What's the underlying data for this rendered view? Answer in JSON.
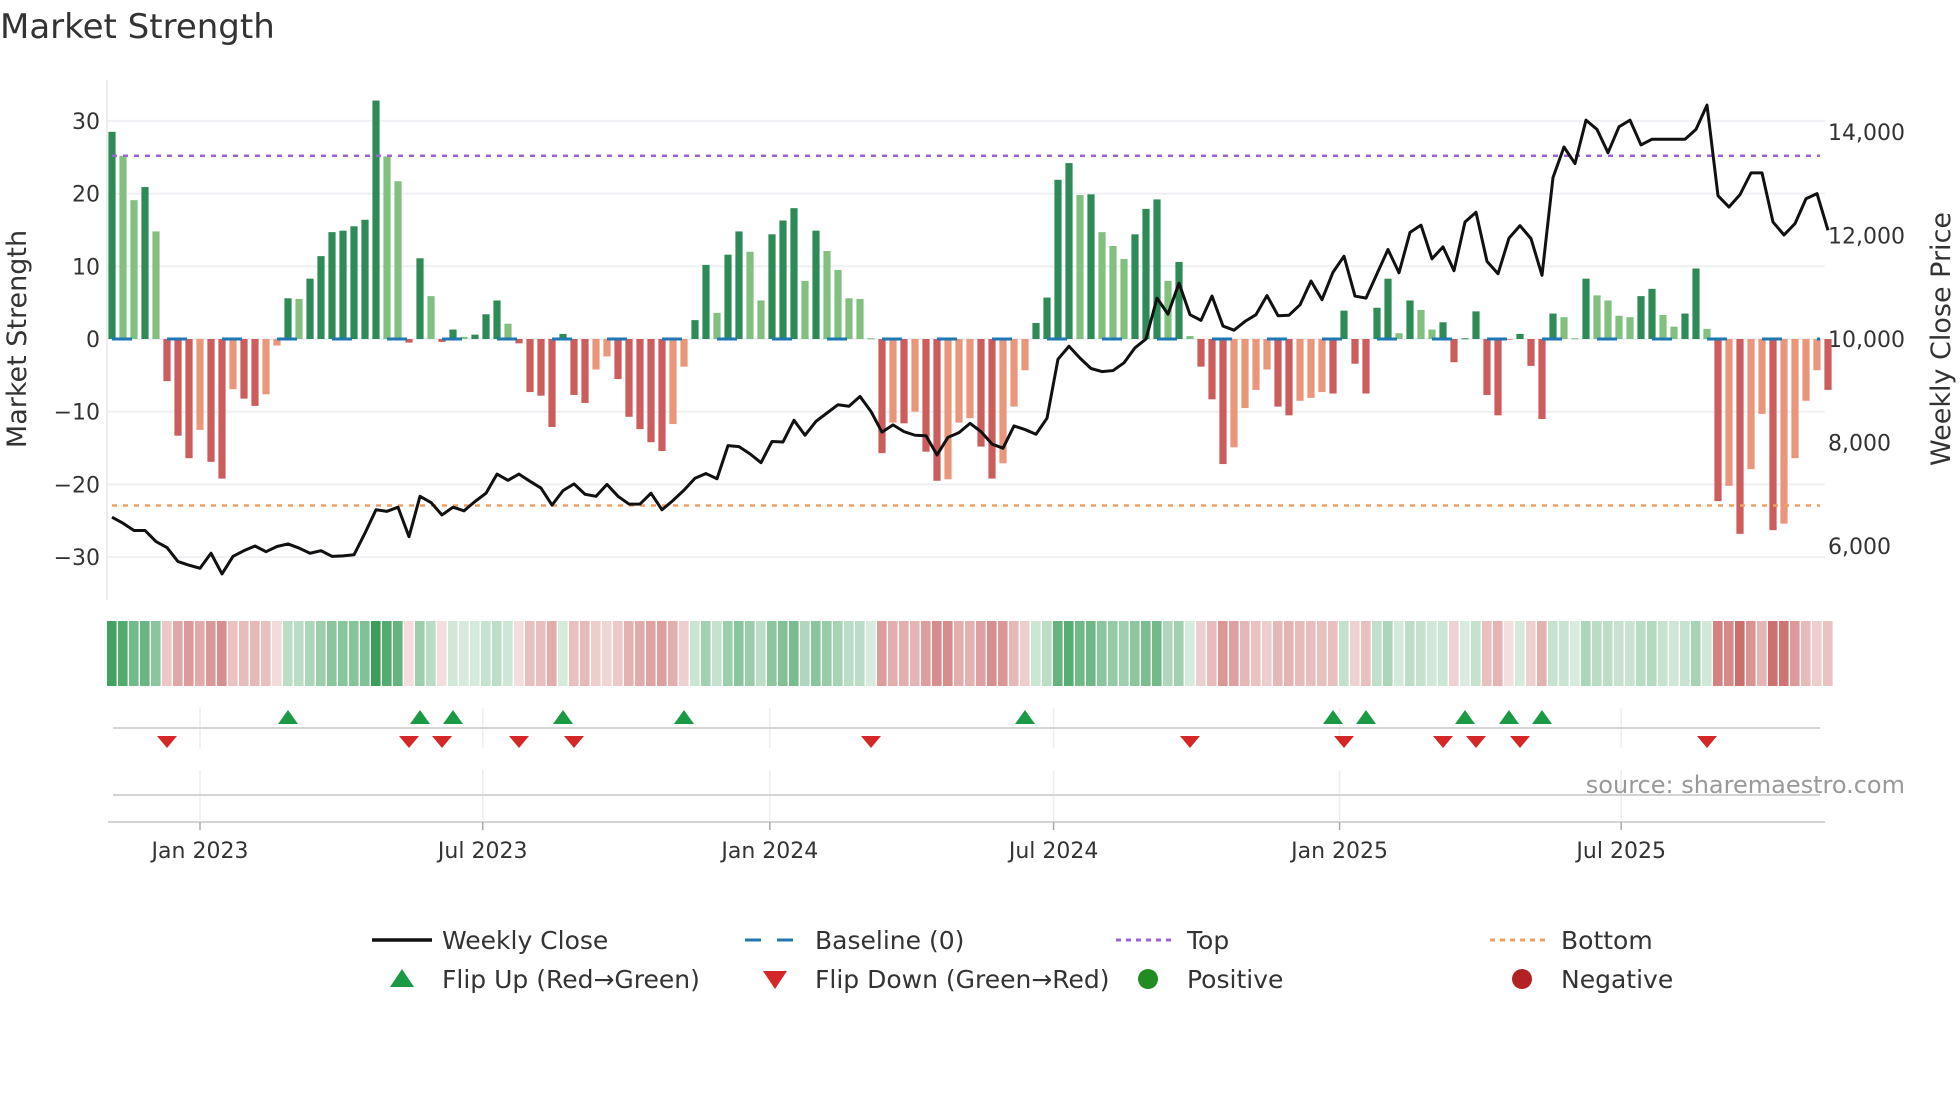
{
  "title": "Market Strength",
  "source": "source: sharemaestro.com",
  "chart_data": {
    "type": "bar",
    "title": "Market Strength",
    "ylabel": "Market Strength",
    "ylabel_right": "Weekly Close Price",
    "ylim": [
      -35.6,
      35.6
    ],
    "ylim_right": [
      4960,
      15000
    ],
    "yticks": [
      30,
      20,
      10,
      0,
      -10,
      -20,
      -30
    ],
    "yticks_right": [
      6000,
      8000,
      10000,
      12000,
      14000
    ],
    "ytick_labels": [
      "30",
      "20",
      "10",
      "0",
      "−10",
      "−20",
      "−30"
    ],
    "ytick_labels_right": [
      "6,000",
      "8,000",
      "10,000",
      "12,000",
      "14,000"
    ],
    "x_unit": "week index (weekly, Nov 2022 – Nov 2025)",
    "xticks": [
      {
        "label": "Jan 2023",
        "week": 8
      },
      {
        "label": "Jul 2023",
        "week": 33.7
      },
      {
        "label": "Jan 2024",
        "week": 59.8
      },
      {
        "label": "Jul 2024",
        "week": 85.6
      },
      {
        "label": "Jan 2025",
        "week": 111.6
      },
      {
        "label": "Jul 2025",
        "week": 137.2
      }
    ],
    "top_threshold": 25.2,
    "bottom_threshold": -22.9,
    "baseline": 0,
    "strength": [
      28.5,
      25.2,
      19.1,
      20.9,
      14.8,
      -5.8,
      -13.3,
      -16.4,
      -12.5,
      -16.9,
      -19.2,
      -6.9,
      -8.2,
      -9.2,
      -7.6,
      -0.9,
      5.6,
      5.5,
      8.3,
      11.4,
      14.7,
      14.9,
      15.5,
      16.4,
      32.8,
      25.1,
      21.7,
      -0.5,
      11.1,
      5.9,
      -0.4,
      1.3,
      0.3,
      0.6,
      3.4,
      5.3,
      2.1,
      -0.6,
      -7.3,
      -7.8,
      -12.1,
      0.7,
      -7.7,
      -8.8,
      -4.2,
      -2.4,
      -5.5,
      -10.7,
      -12.4,
      -14.2,
      -15.4,
      -11.7,
      -3.8,
      2.6,
      10.2,
      3.6,
      11.6,
      14.8,
      12.0,
      5.3,
      14.4,
      16.3,
      18.0,
      8.0,
      14.9,
      12.1,
      9.5,
      5.6,
      5.5,
      0.1,
      -15.7,
      -11.5,
      -11.6,
      -10.0,
      -15.5,
      -19.5,
      -19.3,
      -11.5,
      -10.9,
      -14.8,
      -19.2,
      -17.1,
      -9.3,
      -4.3,
      2.2,
      5.7,
      21.9,
      24.2,
      19.8,
      19.9,
      14.7,
      12.8,
      11.0,
      14.4,
      17.9,
      19.2,
      8.0,
      10.6,
      0.4,
      -3.8,
      -8.3,
      -17.2,
      -14.9,
      -9.5,
      -7.0,
      -4.2,
      -9.3,
      -10.5,
      -8.5,
      -8.1,
      -7.3,
      -7.5,
      3.9,
      -3.4,
      -7.5,
      4.3,
      8.3,
      0.8,
      5.3,
      4.0,
      1.3,
      2.3,
      -3.2,
      0.1,
      3.8,
      -7.7,
      -10.5,
      -0.1,
      0.7,
      -3.7,
      -11.0,
      3.5,
      3.0,
      0.1,
      8.3,
      6.0,
      5.3,
      3.2,
      3.0,
      5.9,
      6.9,
      3.3,
      1.7,
      3.5,
      9.7,
      1.4,
      -22.3,
      -20.2,
      -26.8,
      -17.9,
      -10.3,
      -26.3,
      -25.4,
      -16.4,
      -8.5,
      -4.3,
      -7.0
    ],
    "weekly_close": [
      6556,
      6440,
      6300,
      6300,
      6085,
      5970,
      5700,
      5630,
      5570,
      5860,
      5460,
      5800,
      5910,
      6000,
      5890,
      5990,
      6040,
      5960,
      5860,
      5910,
      5800,
      5810,
      5830,
      6250,
      6700,
      6670,
      6750,
      6180,
      6960,
      6840,
      6600,
      6750,
      6680,
      6860,
      7020,
      7390,
      7270,
      7390,
      7250,
      7120,
      6790,
      7070,
      7200,
      7000,
      6960,
      7190,
      6960,
      6810,
      6810,
      7020,
      6700,
      6880,
      7080,
      7310,
      7400,
      7300,
      7940,
      7920,
      7780,
      7610,
      8020,
      8010,
      8430,
      8140,
      8410,
      8570,
      8730,
      8700,
      8890,
      8600,
      8200,
      8340,
      8210,
      8140,
      8130,
      7760,
      8100,
      8190,
      8370,
      8210,
      7970,
      7890,
      8320,
      8250,
      8160,
      8470,
      9610,
      9860,
      9630,
      9430,
      9370,
      9390,
      9540,
      9830,
      10000,
      10790,
      10480,
      11080,
      10470,
      10360,
      10830,
      10250,
      10170,
      10340,
      10470,
      10840,
      10450,
      10460,
      10660,
      11120,
      10760,
      11290,
      11600,
      10830,
      10790,
      11260,
      11730,
      11280,
      12060,
      12200,
      11550,
      11780,
      11320,
      12260,
      12450,
      11500,
      11260,
      11950,
      12190,
      11940,
      11230,
      13120,
      13710,
      13390,
      14230,
      14050,
      13600,
      14100,
      14230,
      13750,
      13860,
      13860,
      13860,
      13860,
      14050,
      14520,
      12770,
      12550,
      12790,
      13210,
      13210,
      12260,
      12010,
      12230,
      12710,
      12810,
      12100
    ],
    "flip_up_weeks": [
      16,
      28,
      31,
      41,
      52,
      83,
      111,
      114,
      123,
      127,
      130
    ],
    "flip_down_weeks": [
      5,
      27,
      30,
      37,
      42,
      69,
      98,
      112,
      121,
      124,
      128,
      145
    ],
    "legend": {
      "placement": "bottom",
      "items": [
        {
          "label": "Weekly Close",
          "kind": "line"
        },
        {
          "label": "Baseline (0)",
          "kind": "dash"
        },
        {
          "label": "Top",
          "kind": "dot"
        },
        {
          "label": "Bottom",
          "kind": "dot"
        },
        {
          "label": "Flip Up (Red→Green)",
          "kind": "up"
        },
        {
          "label": "Flip Down (Green→Red)",
          "kind": "down"
        },
        {
          "label": "Positive",
          "kind": "circle-pos"
        },
        {
          "label": "Negative",
          "kind": "circle-neg"
        }
      ]
    },
    "colors": {
      "pos_strong": "#2e8b57",
      "pos_weak": "#81c07f",
      "neg_strong": "#cd5c5c",
      "neg_weak": "#e9967a",
      "line": "#111111",
      "baseline": "#1f77b4",
      "top": "#9c63d6",
      "bottom": "#f0a060",
      "flip_up": "#1a9a44",
      "flip_down": "#d62728",
      "positive": "#228b22",
      "negative": "#b22222"
    }
  }
}
